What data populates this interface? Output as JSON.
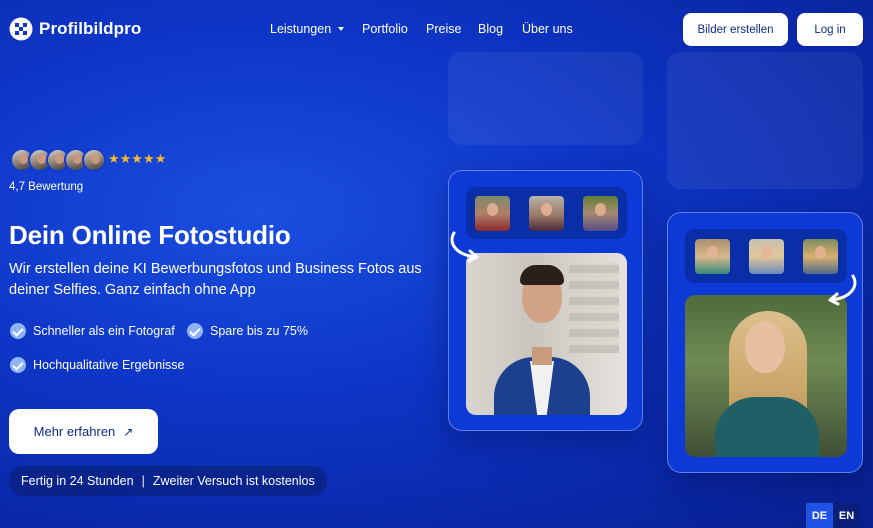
{
  "brand": {
    "name": "Profilbildpro"
  },
  "nav": {
    "links": [
      "Leistungen",
      "Portfolio",
      "Preise",
      "Blog",
      "Über uns"
    ],
    "create_label": "Bilder erstellen",
    "login_label": "Log in"
  },
  "hero": {
    "stars": "★★★★★",
    "rating": "4,7 Bewertung",
    "title": "Dein Online Fotostudio",
    "subtitle": "Wir erstellen deine KI Bewerbungsfotos und Business Fotos aus deiner Selfies. Ganz einfach ohne App",
    "features": [
      "Schneller als ein Fotograf",
      "Spare bis zu 75%",
      "Hochqualitative Ergebnisse"
    ],
    "cta_label": "Mehr erfahren",
    "cta_arrow": "↗",
    "pill": {
      "left": "Fertig in 24 Stunden",
      "sep": "|",
      "right": "Zweiter Versuch ist kostenlos"
    }
  },
  "lang": {
    "de": "DE",
    "en": "EN"
  },
  "colors": {
    "accent": "#0e36c7",
    "button_text": "#0d2a8c",
    "star": "#f7b731"
  }
}
